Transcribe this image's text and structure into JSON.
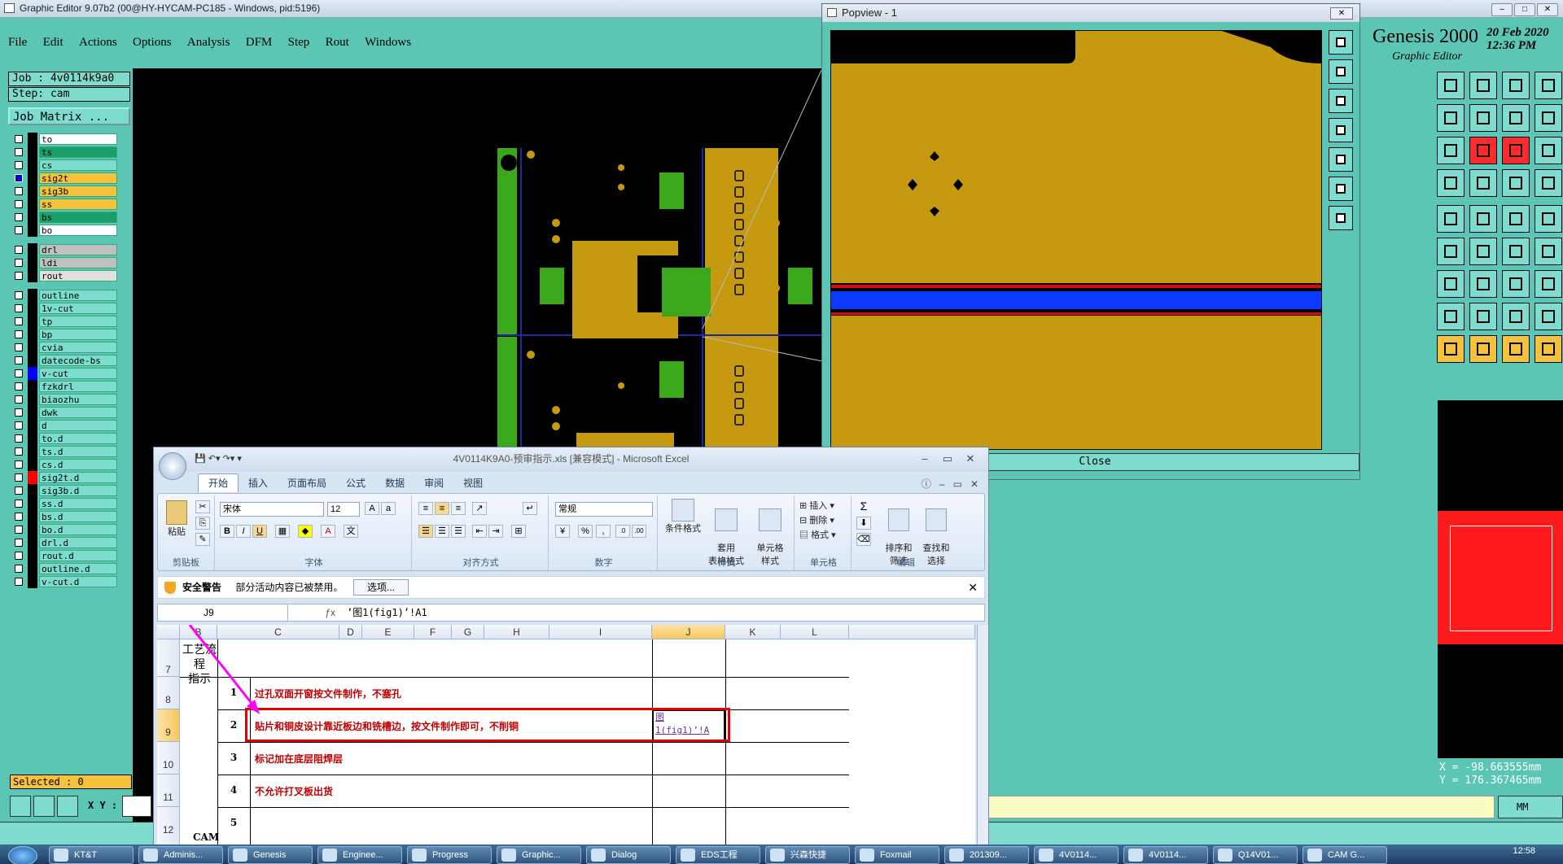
{
  "genesis": {
    "title": "Graphic Editor 9.07b2 (00@HY-HYCAM-PC185 - Windows, pid:5196)",
    "menu": [
      "File",
      "Edit",
      "Actions",
      "Options",
      "Analysis",
      "DFM",
      "Step",
      "Rout",
      "Windows"
    ],
    "job_label": "Job : 4v0114k9a0",
    "step_label": "Step: cam",
    "job_matrix_button": "Job Matrix ...",
    "layers_group1": [
      {
        "name": "to",
        "color": "#ffffff",
        "mark": "✎",
        "checked": false
      },
      {
        "name": "ts",
        "color": "#1a9e6a",
        "mark": "",
        "checked": false
      },
      {
        "name": "cs",
        "color": "#7ddccd",
        "mark": "",
        "checked": false
      },
      {
        "name": "sig2t",
        "color": "#f6c23c",
        "mark": "✎",
        "checked": true
      },
      {
        "name": "sig3b",
        "color": "#f6c23c",
        "mark": "✎",
        "checked": false
      },
      {
        "name": "ss",
        "color": "#f6c23c",
        "mark": "",
        "checked": false
      },
      {
        "name": "bs",
        "color": "#1a9e6a",
        "mark": "",
        "checked": false
      },
      {
        "name": "bo",
        "color": "#ffffff",
        "mark": "✎",
        "checked": false
      }
    ],
    "layers_group2": [
      {
        "name": "drl",
        "color": "#c0c0c0",
        "mark": "",
        "checked": false
      },
      {
        "name": "ldi",
        "color": "#c0c0c0",
        "mark": "",
        "checked": false
      },
      {
        "name": "rout",
        "color": "#e0e0e0",
        "mark": "",
        "checked": false
      }
    ],
    "layers_group3": [
      {
        "name": "outline",
        "color": "#7ddccd",
        "mark": "",
        "checked": false
      },
      {
        "name": "1v-cut",
        "color": "#7ddccd",
        "mark": "",
        "checked": false
      },
      {
        "name": "tp",
        "color": "#7ddccd",
        "mark": "",
        "checked": false
      },
      {
        "name": "bp",
        "color": "#7ddccd",
        "mark": "",
        "checked": false
      },
      {
        "name": "cvia",
        "color": "#7ddccd",
        "mark": "",
        "checked": false
      },
      {
        "name": "datecode-bs",
        "color": "#7ddccd",
        "mark": "",
        "checked": false
      },
      {
        "name": "v-cut",
        "color": "#7ddccd",
        "mark": "",
        "checked": false,
        "swatch": "#0000ff"
      },
      {
        "name": "fzkdrl",
        "color": "#7ddccd",
        "mark": "",
        "checked": false
      },
      {
        "name": "biaozhu",
        "color": "#7ddccd",
        "mark": "",
        "checked": false
      },
      {
        "name": "dwk",
        "color": "#7ddccd",
        "mark": "",
        "checked": false
      },
      {
        "name": "d",
        "color": "#7ddccd",
        "mark": "",
        "checked": false
      },
      {
        "name": "to.d",
        "color": "#7ddccd",
        "mark": "✎",
        "checked": false
      },
      {
        "name": "ts.d",
        "color": "#7ddccd",
        "mark": "",
        "checked": false
      },
      {
        "name": "cs.d",
        "color": "#7ddccd",
        "mark": "",
        "checked": false
      },
      {
        "name": "sig2t.d",
        "color": "#7ddccd",
        "mark": "✎",
        "checked": false,
        "swatch": "#ff0000"
      },
      {
        "name": "sig3b.d",
        "color": "#7ddccd",
        "mark": "✎",
        "checked": false
      },
      {
        "name": "ss.d",
        "color": "#7ddccd",
        "mark": "",
        "checked": false
      },
      {
        "name": "bs.d",
        "color": "#7ddccd",
        "mark": "",
        "checked": false
      },
      {
        "name": "bo.d",
        "color": "#7ddccd",
        "mark": "✎",
        "checked": false
      },
      {
        "name": "drl.d",
        "color": "#7ddccd",
        "mark": "",
        "checked": false
      },
      {
        "name": "rout.d",
        "color": "#7ddccd",
        "mark": "",
        "checked": false
      },
      {
        "name": "outline.d",
        "color": "#7ddccd",
        "mark": "",
        "checked": false
      },
      {
        "name": "v-cut.d",
        "color": "#7ddccd",
        "mark": "",
        "checked": false
      }
    ],
    "selected": "Selected : 0",
    "xy_label": "X Y :",
    "units": "MM",
    "brand": "Genesis 2000",
    "brand_sub": "Graphic Editor",
    "date_line1": "20 Feb 2020",
    "date_line2": "12:36 PM",
    "coord_x": "X = -98.663555mm",
    "coord_y": "Y = 176.367465mm"
  },
  "popview": {
    "title": "Popview - 1",
    "close_button": "Close"
  },
  "excel": {
    "title": "4V0114K9A0-预审指示.xls  [兼容模式] - Microsoft Excel",
    "tabs": [
      "开始",
      "插入",
      "页面布局",
      "公式",
      "数据",
      "审阅",
      "视图"
    ],
    "font_name": "宋体",
    "font_size": "12",
    "number_format": "常规",
    "groups": [
      "剪贴板",
      "字体",
      "对齐方式",
      "数字",
      "样式",
      "单元格",
      "编辑"
    ],
    "paste": "粘贴",
    "cond_format": "条件格式",
    "table_format": "套用\n表格格式",
    "cell_style": "单元格\n样式",
    "insert": "插入",
    "delete": "删除",
    "format": "格式",
    "sort_filter": "排序和\n筛选",
    "find_select": "查找和\n选择",
    "security_title": "安全警告",
    "security_msg": "部分活动内容已被禁用。",
    "options_button": "选项...",
    "name_box": "J9",
    "formula": "’图1(fig1)’!A1",
    "columns": [
      "B",
      "C",
      "D",
      "E",
      "F",
      "G",
      "H",
      "I",
      "J",
      "K",
      "L"
    ],
    "rows": [
      "7",
      "8",
      "9",
      "10",
      "11",
      "12"
    ],
    "b7": "工艺流程\n指示",
    "items": [
      {
        "num": "1",
        "text": "过孔双面开窗按文件制作，不塞孔"
      },
      {
        "num": "2",
        "text": "贴片和铜皮设计靠近板边和铣槽边，按文件制作即可，不削铜"
      },
      {
        "num": "3",
        "text": "标记加在底层阻焊层"
      },
      {
        "num": "4",
        "text": "不允许打叉板出货"
      },
      {
        "num": "5",
        "text": ""
      }
    ],
    "j9_line1": "图",
    "j9_line2": "1(fig1)’!A",
    "cam_label": "CAM"
  },
  "taskbar": {
    "items": [
      "KT&T",
      "Adminis...",
      "Genesis",
      "Enginee...",
      "Progress",
      "Graphic...",
      "Dialog",
      "EDS工程",
      "兴森快捷",
      "Foxmail",
      "201309...",
      "4V0114...",
      "4V0114...",
      "Q14V01...",
      "CAM G..."
    ],
    "time": "12:58"
  }
}
